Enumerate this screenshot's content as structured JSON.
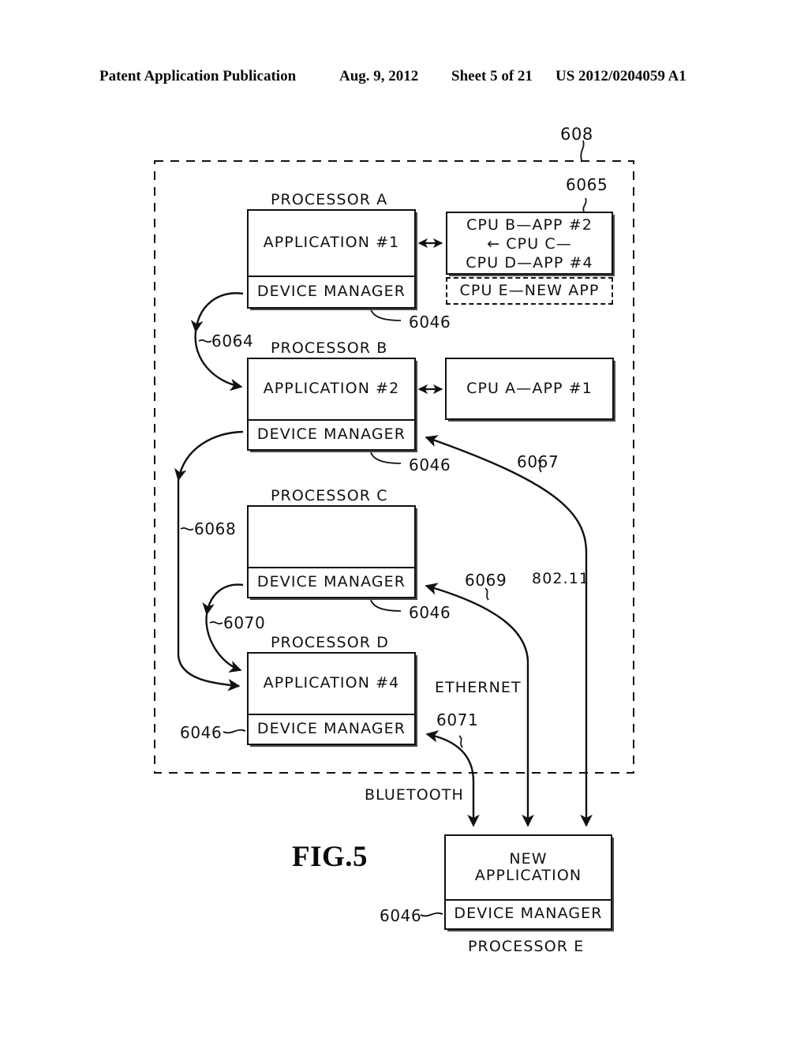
{
  "header": {
    "publication": "Patent Application Publication",
    "date": "Aug. 9, 2012",
    "sheet": "Sheet 5 of 21",
    "number": "US 2012/0204059 A1"
  },
  "figure": {
    "caption": "FIG.5",
    "system_ref": "608"
  },
  "processors": [
    {
      "id": "a",
      "title": "PROCESSOR A",
      "application": "APPLICATION #1",
      "device_manager": "DEVICE MANAGER",
      "dm_ref": "6046"
    },
    {
      "id": "b",
      "title": "PROCESSOR B",
      "application": "APPLICATION #2",
      "device_manager": "DEVICE MANAGER",
      "dm_ref": "6046"
    },
    {
      "id": "c",
      "title": "PROCESSOR C",
      "application": "",
      "device_manager": "DEVICE MANAGER",
      "dm_ref": "6046"
    },
    {
      "id": "d",
      "title": "PROCESSOR D",
      "application": "APPLICATION #4",
      "device_manager": "DEVICE MANAGER",
      "dm_ref": "6046"
    },
    {
      "id": "e",
      "title": "PROCESSOR E",
      "application": "NEW\nAPPLICATION",
      "device_manager": "DEVICE MANAGER",
      "dm_ref": "6046"
    }
  ],
  "side_boxes": {
    "cpu_table": {
      "ref": "6065",
      "line1": "CPU B—APP #2",
      "line2": "← CPU C—",
      "line3": "CPU D—APP #4",
      "pending": "CPU E—NEW APP"
    },
    "cpu_a_app": {
      "label": "CPU A—APP #1"
    }
  },
  "connections": [
    {
      "ref": "6064",
      "label": ""
    },
    {
      "ref": "6068",
      "label": ""
    },
    {
      "ref": "6070",
      "label": ""
    },
    {
      "ref": "6067",
      "label": "802.11"
    },
    {
      "ref": "6069",
      "label": "ETHERNET"
    },
    {
      "ref": "6071",
      "label": "BLUETOOTH"
    }
  ],
  "network_labels": {
    "wifi": "802.11",
    "ethernet": "ETHERNET",
    "bluetooth": "BLUETOOTH"
  }
}
